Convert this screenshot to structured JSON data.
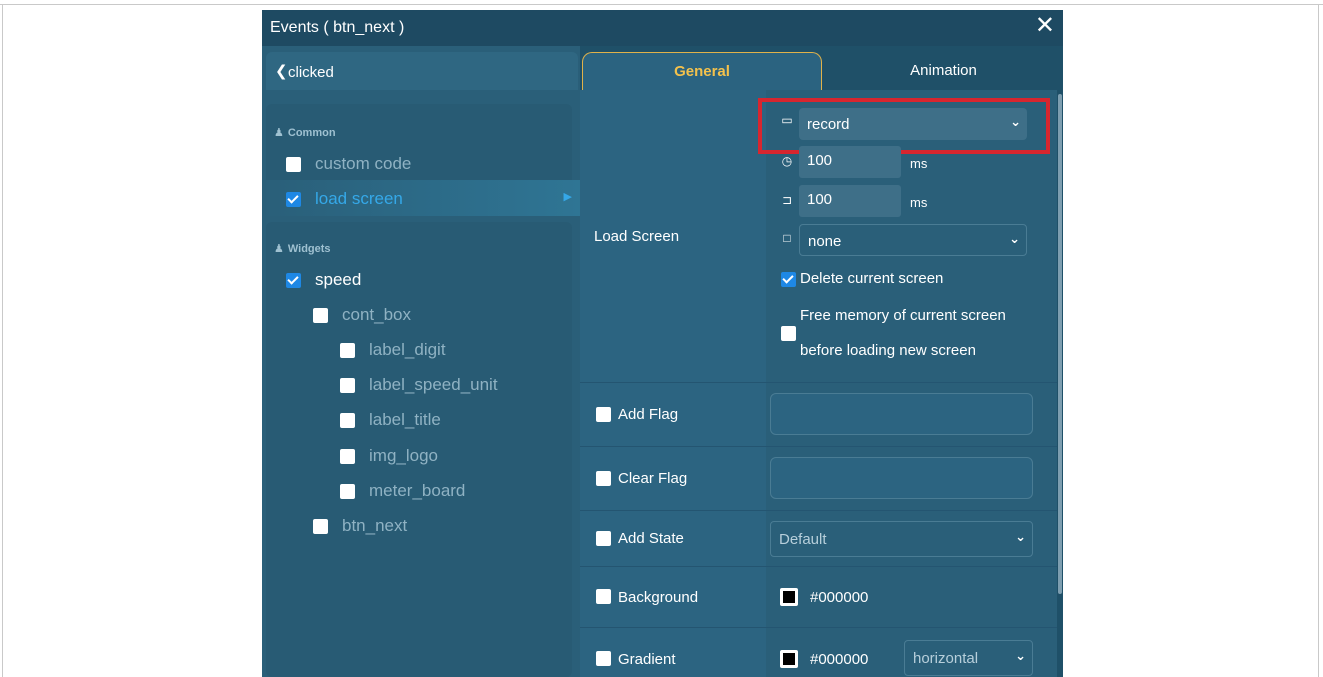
{
  "window": {
    "title": "Events ( btn_next )",
    "close_glyph": "✕"
  },
  "event": {
    "back_glyph": "❮",
    "name": "clicked"
  },
  "groups": {
    "common_label": "Common",
    "widgets_label": "Widgets",
    "group_icon": "user-icon"
  },
  "tree": {
    "common": [
      {
        "label": "custom code",
        "checked": false
      },
      {
        "label": "load screen",
        "checked": true,
        "selected": true
      }
    ],
    "widgets": [
      {
        "label": "speed",
        "checked": true
      },
      {
        "label": "cont_box",
        "checked": false
      },
      {
        "label": "label_digit",
        "checked": false
      },
      {
        "label": "label_speed_unit",
        "checked": false
      },
      {
        "label": "label_title",
        "checked": false
      },
      {
        "label": "img_logo",
        "checked": false
      },
      {
        "label": "meter_board",
        "checked": false
      },
      {
        "label": "btn_next",
        "checked": false
      }
    ]
  },
  "tabs": {
    "general": "General",
    "animation": "Animation",
    "active": "General"
  },
  "load_screen": {
    "label": "Load Screen",
    "screen_value": "record",
    "time_value": "100",
    "time_unit": "ms",
    "delay_value": "100",
    "delay_unit": "ms",
    "anim_value": "none",
    "delete_current_label": "Delete current screen",
    "delete_current_checked": true,
    "free_memory_line1": "Free memory of current screen",
    "free_memory_line2": "before loading new screen",
    "free_memory_checked": false
  },
  "options": {
    "add_flag": "Add Flag",
    "clear_flag": "Clear Flag",
    "add_state": "Add State",
    "add_state_value": "Default",
    "background": "Background",
    "background_color": "#000000",
    "gradient": "Gradient",
    "gradient_color": "#000000",
    "gradient_direction": "horizontal"
  },
  "colors": {
    "dialog_bg": "#1f5068",
    "panel_bg": "#2a5f79",
    "accent_blue": "#1e88e5",
    "selected_text": "#35a8e8",
    "tab_active_text": "#f3c14c",
    "highlight_red": "#d7262f"
  }
}
